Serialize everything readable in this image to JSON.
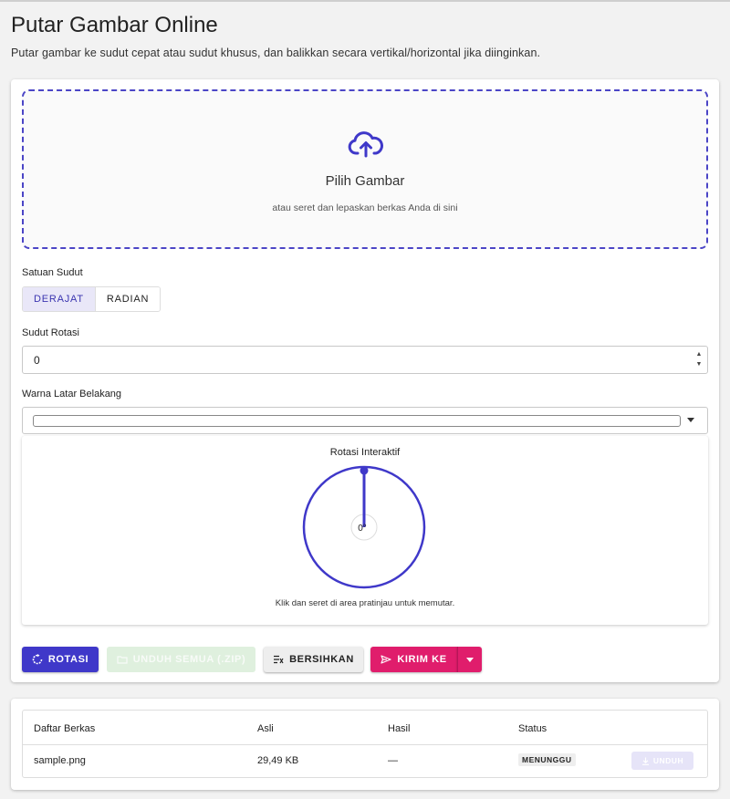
{
  "page": {
    "title": "Putar Gambar Online",
    "subtitle": "Putar gambar ke sudut cepat atau sudut khusus, dan balikkan secara vertikal/horizontal jika diinginkan."
  },
  "dropzone": {
    "icon": "cloud-upload-icon",
    "title": "Pilih Gambar",
    "hint": "atau seret dan lepaskan berkas Anda di sini"
  },
  "angle_unit": {
    "label": "Satuan Sudut",
    "options": [
      "DERAJAT",
      "RADIAN"
    ],
    "selected": "DERAJAT"
  },
  "rotation_angle": {
    "label": "Sudut Rotasi",
    "value": "0"
  },
  "background_color": {
    "label": "Warna Latar Belakang",
    "value": "#ffffff"
  },
  "interactive_rotation": {
    "title": "Rotasi Interaktif",
    "angle_readout": "0°",
    "hint": "Klik dan seret di area pratinjau untuk memutar."
  },
  "actions": {
    "rotate": "ROTASI",
    "download_zip": "UNDUH SEMUA (.ZIP)",
    "clear": "BERSIHKAN",
    "send_to": "KIRIM KE"
  },
  "files": {
    "headers": [
      "Daftar Berkas",
      "Asli",
      "Hasil",
      "Status"
    ],
    "rows": [
      {
        "name": "sample.png",
        "original": "29,49 KB",
        "result": "—",
        "status": "MENUNGGU",
        "action": "UNDUH"
      }
    ]
  },
  "colors": {
    "primary": "#3f38c9",
    "accent": "#e01d6c",
    "success_disabled": "#dff0de"
  }
}
